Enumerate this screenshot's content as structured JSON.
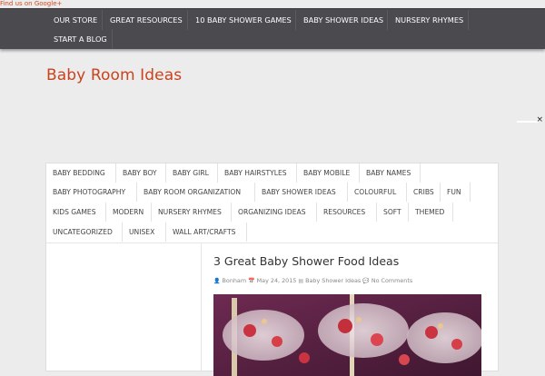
{
  "header": {
    "google_link": "Find us on Google+"
  },
  "top_nav": {
    "items": [
      "OUR STORE",
      "GREAT RESOURCES",
      "10 BABY SHOWER GAMES",
      "BABY SHOWER IDEAS",
      "NURSERY RHYMES",
      "START A BLOG"
    ]
  },
  "site": {
    "title": "Baby Room Ideas"
  },
  "close_label": "×",
  "categories": [
    "BABY BEDDING",
    "BABY BOY",
    "BABY GIRL",
    "BABY HAIRSTYLES",
    "BABY MOBILE",
    "BABY NAMES",
    "BABY PHOTOGRAPHY",
    "BABY ROOM ORGANIZATION",
    "BABY SHOWER IDEAS",
    "COLOURFUL",
    "CRIBS",
    "FUN",
    "KIDS GAMES",
    "MODERN",
    "NURSERY RHYMES",
    "ORGANIZING IDEAS",
    "RESOURCES",
    "SOFT",
    "THEMED",
    "UNCATEGORIZED",
    "UNISEX",
    "WALL ART/CRAFTS"
  ],
  "post": {
    "title": "3 Great Baby Shower Food Ideas",
    "author": "Bonham",
    "date": "May 24, 2015",
    "category": "Baby Shower Ideas",
    "comments": "No Comments"
  },
  "colors": {
    "accent": "#c8431e",
    "nav_bg": "#4a4a4f"
  }
}
